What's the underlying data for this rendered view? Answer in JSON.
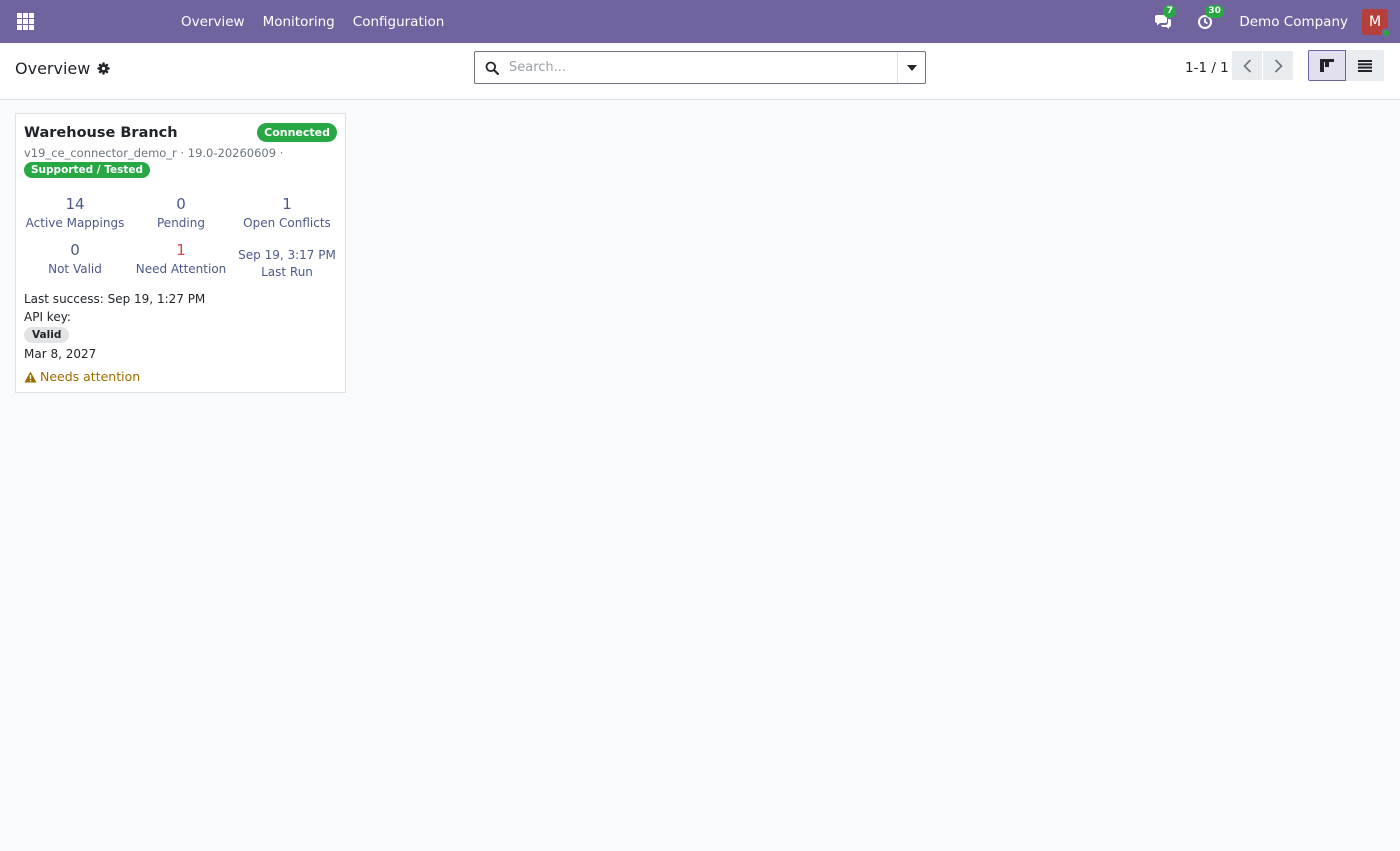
{
  "navbar": {
    "menu": [
      "Overview",
      "Monitoring",
      "Configuration"
    ],
    "messages_count": "7",
    "activities_count": "30",
    "company": "Demo Company",
    "avatar_initial": "M",
    "color": "#71639e"
  },
  "control": {
    "breadcrumb": "Overview",
    "search_placeholder": "Search...",
    "pager": "1-1 / 1"
  },
  "card": {
    "title": "Warehouse Branch",
    "status": "Connected",
    "subtitle": "v19_ce_connector_demo_r · 19.0-20260609 ·",
    "support_badge": "Supported / Tested",
    "stats": [
      {
        "value": "14",
        "label": "Active Mappings"
      },
      {
        "value": "0",
        "label": "Pending"
      },
      {
        "value": "1",
        "label": "Open Conflicts"
      },
      {
        "value": "0",
        "label": "Not Valid"
      },
      {
        "value": "1",
        "label": "Need Attention"
      },
      {
        "value": "Sep 19, 3:17 PM",
        "label": "Last Run"
      }
    ],
    "last_success": "Last success: Sep 19, 1:27 PM",
    "api_key_label": "API key:",
    "api_key_status": "Valid",
    "api_key_expiry": "Mar 8, 2027",
    "attention": "Needs attention"
  },
  "colors": {
    "accent": "#71639e",
    "success": "#28a745",
    "danger": "#d44c4c",
    "warning": "#9a6c00"
  }
}
